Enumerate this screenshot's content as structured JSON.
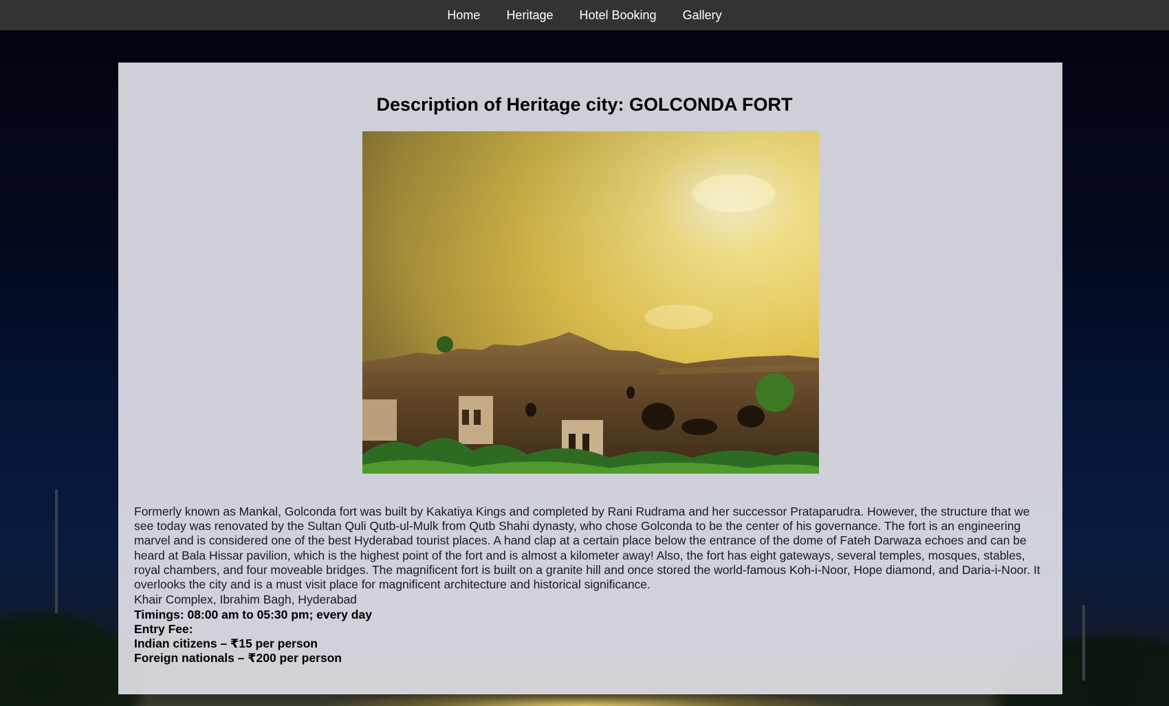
{
  "nav": {
    "items": [
      {
        "label": "Home"
      },
      {
        "label": "Heritage"
      },
      {
        "label": "Hotel Booking"
      },
      {
        "label": "Gallery"
      }
    ]
  },
  "page": {
    "title": "Description of Heritage city: GOLCONDA FORT",
    "description": "Formerly known as Mankal, Golconda fort was built by Kakatiya Kings and completed by Rani Rudrama and her successor Prataparudra. However, the structure that we see today was renovated by the Sultan Quli Qutb-ul-Mulk from Qutb Shahi dynasty, who chose Golconda to be the center of his governance. The fort is an engineering marvel and is considered one of the best Hyderabad tourist places. A hand clap at a certain place below the entrance of the dome of Fateh Darwaza echoes and can be heard at Bala Hissar pavilion, which is the highest point of the fort and is almost a kilometer away! Also, the fort has eight gateways, several temples, mosques, stables, royal chambers, and four moveable bridges. The magnificent fort is built on a granite hill and once stored the world-famous Koh-i-Noor, Hope diamond, and Daria-i-Noor. It overlooks the city and is a must visit place for magnificent architecture and historical significance.",
    "address": "Khair Complex, Ibrahim Bagh, Hyderabad",
    "timings": "Timings: 08:00 am to 05:30 pm; every day",
    "entry_fee_label": "Entry Fee:",
    "fee_indian": "Indian citizens – ₹15 per person",
    "fee_foreign": "Foreign nationals – ₹200 per person"
  },
  "colors": {
    "navbar": "#333333",
    "card": "#e1e1e8",
    "sky": "#e9c84a"
  }
}
